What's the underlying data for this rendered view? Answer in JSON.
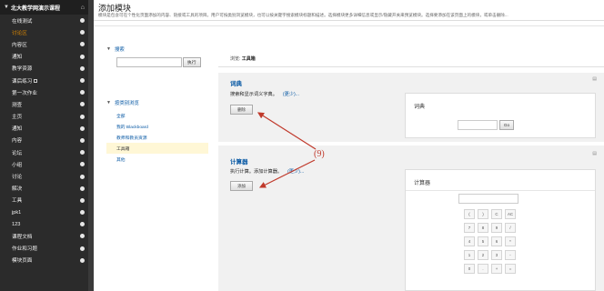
{
  "sidebar": {
    "course_title": "北大教学网演示课程",
    "items": [
      {
        "label": "在线测试"
      },
      {
        "label": "讨论区",
        "active": true
      },
      {
        "label": "内容区"
      },
      {
        "label": "通知"
      },
      {
        "label": "教学资源"
      },
      {
        "label": "课后练习",
        "badge": true
      },
      {
        "label": "第一次作业"
      },
      {
        "label": "测查"
      },
      {
        "label": "主页"
      },
      {
        "label": "通知"
      },
      {
        "label": "内容"
      },
      {
        "label": "论坛"
      },
      {
        "label": "小组"
      },
      {
        "label": "讨论"
      },
      {
        "label": "解决"
      },
      {
        "label": "工具"
      },
      {
        "label": "jpk1"
      },
      {
        "label": "123"
      },
      {
        "label": "课程文档"
      },
      {
        "label": "作业和习题"
      },
      {
        "label": "模块页面"
      }
    ]
  },
  "main": {
    "title": "添加模块",
    "description": "模块是包含可在个性化页面添加的内容、链接或工具的项目。用户可按类别浏览模块，也可以按关键字搜索模块标题和描述。选择模块更多详细信息或显示/隐藏开关来预览模块。选择要添加在该页面上的模块，或单击删除..."
  },
  "left_panel": {
    "search_title": "搜索",
    "search_placeholder": "",
    "go_label": "执行",
    "browse_title": "按类别浏览",
    "categories": [
      "全部",
      "我的 Blackboard",
      "教师和教员资源",
      "工具箱",
      "其他"
    ],
    "selected_category": "工具箱"
  },
  "browse": {
    "prefix": "浏览:",
    "current": "工具箱"
  },
  "modules": [
    {
      "title": "词典",
      "description": "搜索和显示词义字典。",
      "more": "(更少)...",
      "button": "删除",
      "preview_title": "词典",
      "go_label": "Go"
    },
    {
      "title": "计算器",
      "description": "执行计算。添加计算器。",
      "more": "(更少)...",
      "button": "添加",
      "preview_title": "计算器"
    }
  ],
  "calculator_keys": [
    "(",
    ")",
    "C",
    "AC",
    "7",
    "8",
    "9",
    "/",
    "4",
    "5",
    "6",
    "*",
    "1",
    "2",
    "3",
    "-",
    "0",
    ".",
    "+",
    "="
  ],
  "annotation": {
    "label": "(9)",
    "color": "#c0392b"
  }
}
